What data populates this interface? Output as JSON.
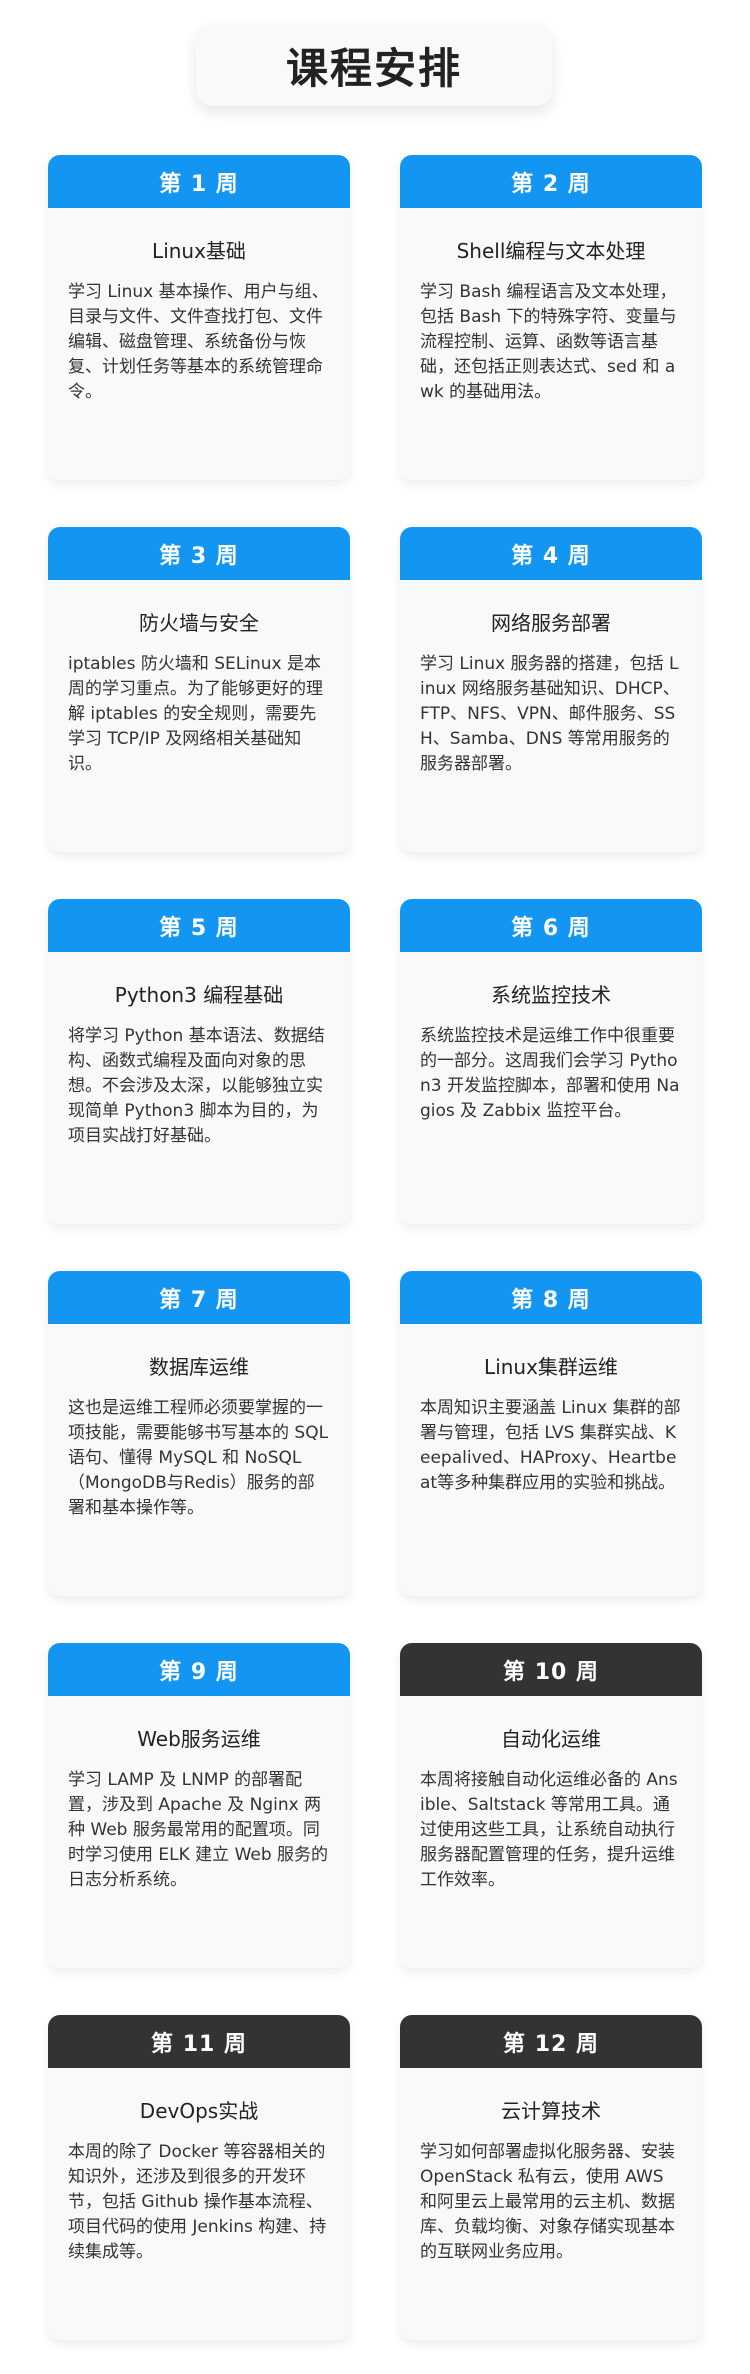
{
  "page_title": "课程安排",
  "weeks": [
    {
      "week": "第 1 周",
      "title": "Linux基础",
      "desc": "学习 Linux 基本操作、用户与组、目录与文件、文件查找打包、文件编辑、磁盘管理、系统备份与恢复、计划任务等基本的系统管理命令。"
    },
    {
      "week": "第 2 周",
      "title": "Shell编程与文本处理",
      "desc": "学习 Bash 编程语言及文本处理，包括 Bash 下的特殊字符、变量与流程控制、运算、函数等语言基础，还包括正则表达式、sed 和 awk 的基础用法。"
    },
    {
      "week": "第 3 周",
      "title": "防火墙与安全",
      "desc": "iptables 防火墙和 SELinux 是本周的学习重点。为了能够更好的理解 iptables 的安全规则，需要先学习 TCP/IP 及网络相关基础知识。"
    },
    {
      "week": "第 4 周",
      "title": "网络服务部署",
      "desc": "学习 Linux 服务器的搭建，包括 Linux 网络服务基础知识、DHCP、FTP、NFS、VPN、邮件服务、SSH、Samba、DNS 等常用服务的服务器部署。"
    },
    {
      "week": "第 5 周",
      "title": "Python3 编程基础",
      "desc": "将学习 Python 基本语法、数据结构、函数式编程及面向对象的思想。不会涉及太深，以能够独立实现简单 Python3 脚本为目的，为项目实战打好基础。"
    },
    {
      "week": "第 6 周",
      "title": "系统监控技术",
      "desc": "系统监控技术是运维工作中很重要的一部分。这周我们会学习 Python3 开发监控脚本，部署和使用 Nagios 及 Zabbix 监控平台。"
    },
    {
      "week": "第 7 周",
      "title": "数据库运维",
      "desc": "这也是运维工程师必须要掌握的一项技能，需要能够书写基本的 SQL 语句、懂得 MySQL 和 NoSQL（MongoDB与Redis）服务的部署和基本操作等。"
    },
    {
      "week": "第 8 周",
      "title": "Linux集群运维",
      "desc": "本周知识主要涵盖 Linux 集群的部署与管理，包括 LVS 集群实战、Keepalived、HAProxy、Heartbeat等多种集群应用的实验和挑战。"
    },
    {
      "week": "第 9 周",
      "title": "Web服务运维",
      "desc": "学习 LAMP 及 LNMP 的部署配置，涉及到 Apache 及 Nginx 两种 Web 服务最常用的配置项。同时学习使用 ELK 建立 Web 服务的日志分析系统。"
    },
    {
      "week": "第 10 周",
      "title": "自动化运维",
      "desc": "本周将接触自动化运维必备的 Ansible、Saltstack 等常用工具。通过使用这些工具，让系统自动执行服务器配置管理的任务，提升运维工作效率。"
    },
    {
      "week": "第 11 周",
      "title": "DevOps实战",
      "desc": "本周的除了 Docker 等容器相关的知识外，还涉及到很多的开发环节，包括 Github 操作基本流程、项目代码的使用 Jenkins 构建、持续集成等。"
    },
    {
      "week": "第 12 周",
      "title": "云计算技术",
      "desc": "学习如何部署虚拟化服务器、安装 OpenStack 私有云，使用 AWS 和阿里云上最常用的云主机、数据库、负载均衡、对象存储实现基本的互联网业务应用。"
    }
  ],
  "colors": {
    "week_header_blue": "#1296f2",
    "week_header_dark": "#333333",
    "card_background": "#f9f9f9"
  }
}
